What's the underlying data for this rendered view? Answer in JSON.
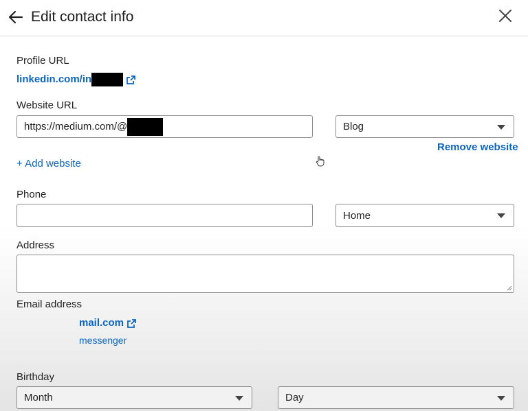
{
  "header": {
    "title": "Edit contact info"
  },
  "profile": {
    "label": "Profile URL",
    "url_prefix": "linkedin.com/in"
  },
  "website": {
    "label": "Website URL",
    "value": "https://medium.com/@",
    "type_selected": "Blog",
    "remove_label": "Remove website",
    "add_label": "+ Add website"
  },
  "phone": {
    "label": "Phone",
    "value": "",
    "type_selected": "Home"
  },
  "address": {
    "label": "Address",
    "value": ""
  },
  "email": {
    "label": "Email address",
    "value_suffix": "mail.com",
    "messenger_label": "messenger"
  },
  "birthday": {
    "label": "Birthday",
    "month_selected": "Month",
    "day_selected": "Day"
  },
  "icons": {
    "back": "arrow-left-icon",
    "close": "close-icon",
    "external": "external-link-icon"
  },
  "colors": {
    "link": "#0a66c2",
    "border": "#8c8c8c"
  }
}
